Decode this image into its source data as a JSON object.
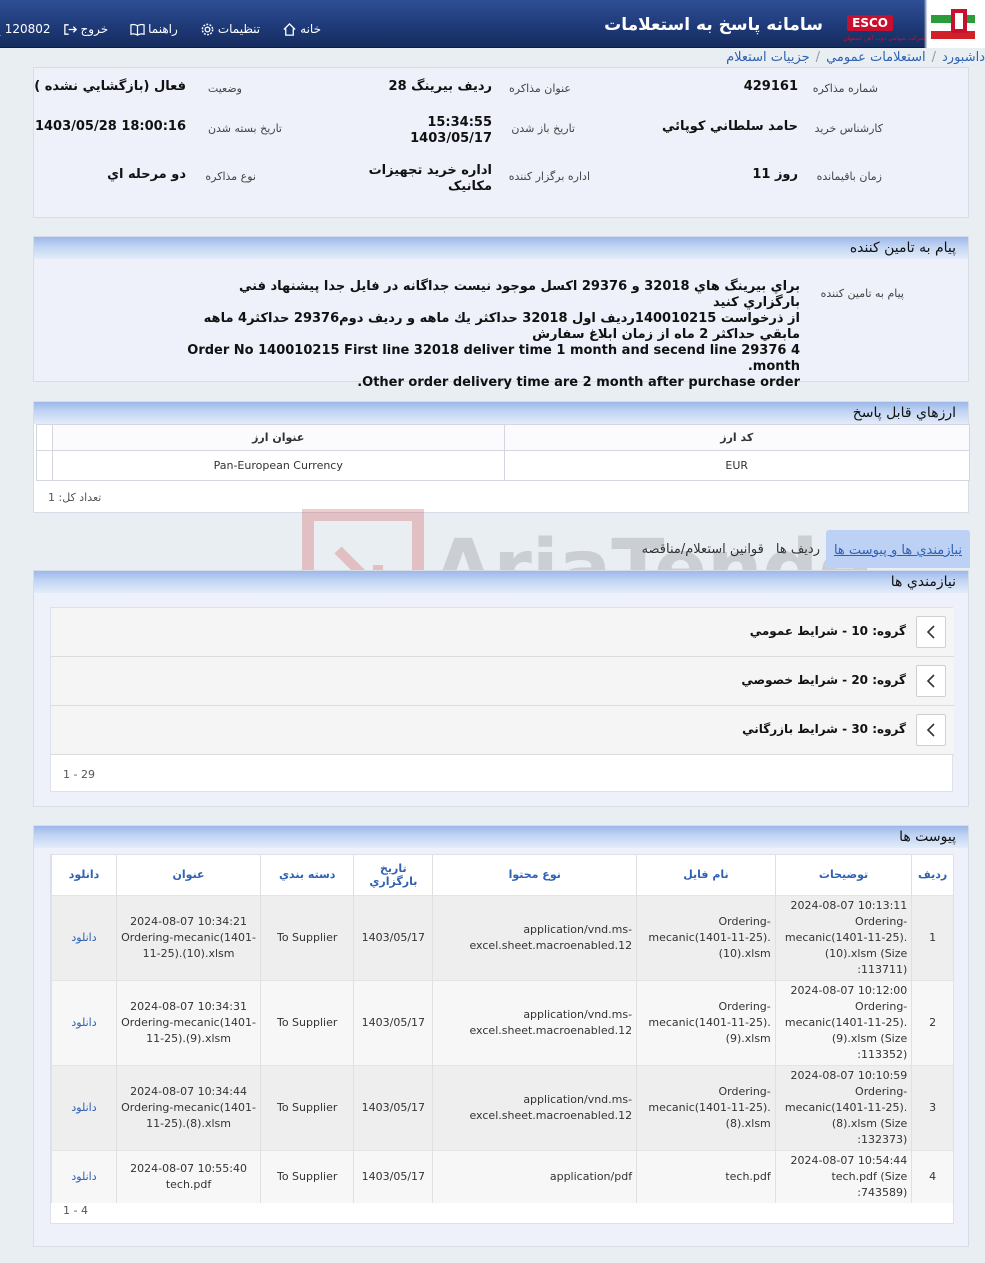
{
  "header": {
    "title": "سامانه پاسخ به استعلامات",
    "esco_label": "ESCO",
    "esco_sub": "شرکت سهامی ذوب آهن اصفهان",
    "nav": {
      "home": "خانه",
      "settings": "تنظيمات",
      "guide": "راهنما",
      "logout": "خروج",
      "user_id": "120802"
    }
  },
  "breadcrumb": [
    "داشبورد",
    "استعلامات عمومي",
    "جزييات استعلام"
  ],
  "info": {
    "number_label": "شماره مذاکره",
    "number_value": "429161",
    "subject_label": "عنوان مذاکره",
    "subject_value": "28 رديف بيرينگ",
    "status_label": "وضعيت",
    "status_value": "فعال (بازگشايي نشده )",
    "expert_label": "کارشناس خريد",
    "expert_value": "حامد سلطاني کوپائي",
    "open_date_label": "تاريخ باز شدن",
    "open_time_value": "15:34:55",
    "open_date_value": "1403/05/17",
    "close_date_label": "تاريخ بسته شدن",
    "close_date_value": "1403/05/28 18:00:16",
    "remaining_label": "زمان باقيمانده",
    "remaining_value": "11 روز",
    "org_label": "اداره برگزار کننده",
    "org_value_1": "اداره خريد تجهيزات",
    "org_value_2": "مکانيک",
    "type_label": "نوع مذاکره",
    "type_value": "دو مرحله اي"
  },
  "supplier_message": {
    "title": "پيام به تامين کننده",
    "label": "پيام به تامين کننده",
    "lines": [
      "براي بيرينگ هاي 32018 و 29376 اکسل موجود نيست جداگانه در فايل جدا پيشنهاد فني بارگزاري کنيد",
      "از ذرخواست 140010215رديف اول 32018 حداکثر يك ماهه و رديف دوم29376 حداکثر4 ماهه",
      "مابقي حداکثر 2 ماه از زمان ابلاغ سفارش",
      "Order No 140010215 First line 32018 deliver time 1 month and secend line 29376 4 month.",
      "Other order delivery time are 2 month after purchase order."
    ]
  },
  "currencies": {
    "title": "ارزهاي قابل پاسخ",
    "col_code": "کد ارز",
    "col_name": "عنوان ارز",
    "rows": [
      {
        "code": "EUR",
        "name": "Pan-European Currency"
      }
    ],
    "count": "تعداد کل: 1"
  },
  "tabs": [
    "نيازمندي ها و پيوست ها",
    "رديف ها",
    "قوانين استعلام/مناقصه"
  ],
  "requirements": {
    "title": "نيازمندي ها",
    "groups": [
      "گروه: 10 - شرايط عمومي",
      "گروه: 20 - شرايط خصوصي",
      "گروه: 30 - شرايط بازرگاني"
    ],
    "pager": "1 - 29"
  },
  "attachments": {
    "title": "پيوست ها",
    "columns": [
      "رديف",
      "توضيحات",
      "نام فايل",
      "نوع محتوا",
      "تاريخ بارگزاري",
      "دسته بندي",
      "عنوان",
      "دانلود"
    ],
    "rows": [
      {
        "idx": "1",
        "desc": "2024-08-07 10:13:11 Ordering-mecanic(1401-11-25). (10).xlsm (Size :113711)",
        "file": "Ordering-mecanic(1401-11-25). (10).xlsm",
        "type": "application/vnd.ms-excel.sheet.macroenabled.12",
        "date": "1403/05/17",
        "cat": "To Supplier",
        "title": "2024-08-07 10:34:21 Ordering-mecanic(1401-11-25).(10).xlsm",
        "dl": "دانلود"
      },
      {
        "idx": "2",
        "desc": "2024-08-07 10:12:00 Ordering-mecanic(1401-11-25). (9).xlsm (Size :113352)",
        "file": "Ordering-mecanic(1401-11-25). (9).xlsm",
        "type": "application/vnd.ms-excel.sheet.macroenabled.12",
        "date": "1403/05/17",
        "cat": "To Supplier",
        "title": "2024-08-07 10:34:31 Ordering-mecanic(1401-11-25).(9).xlsm",
        "dl": "دانلود"
      },
      {
        "idx": "3",
        "desc": "2024-08-07 10:10:59 Ordering-mecanic(1401-11-25). (8).xlsm (Size :132373)",
        "file": "Ordering-mecanic(1401-11-25). (8).xlsm",
        "type": "application/vnd.ms-excel.sheet.macroenabled.12",
        "date": "1403/05/17",
        "cat": "To Supplier",
        "title": "2024-08-07 10:34:44 Ordering-mecanic(1401-11-25).(8).xlsm",
        "dl": "دانلود"
      },
      {
        "idx": "4",
        "desc": "2024-08-07 10:54:44 tech.pdf (Size :743589)",
        "file": "tech.pdf",
        "type": "application/pdf",
        "date": "1403/05/17",
        "cat": "To Supplier",
        "title": "2024-08-07 10:55:40 tech.pdf",
        "dl": "دانلود"
      }
    ],
    "pager": "1 - 4"
  },
  "watermark": "AriaTender.neT"
}
